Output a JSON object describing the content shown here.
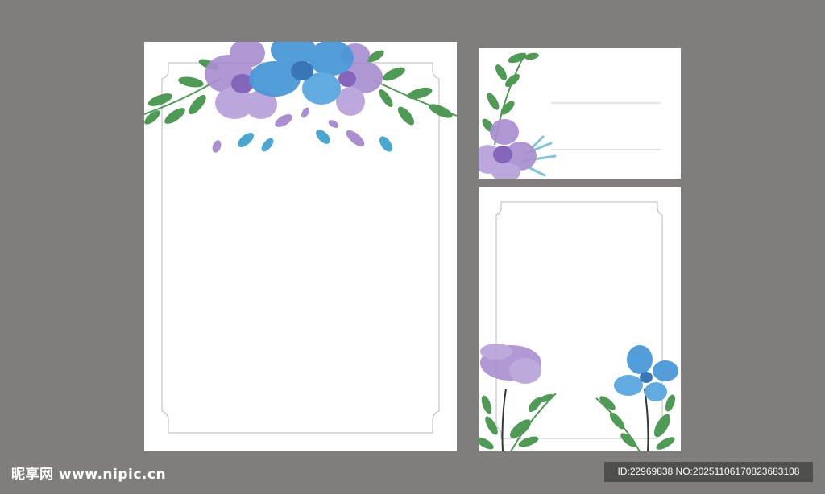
{
  "colors": {
    "background": "#7f7e7c",
    "card": "#ffffff",
    "frame_line": "#b9b9b9",
    "purple": "#a98fd0",
    "purple_dark": "#7b58b5",
    "blue": "#4a98d8",
    "blue_dark": "#2f6fb3",
    "leaf": "#4f9a55"
  },
  "watermark": {
    "site": "昵享网 www.nipic.cn",
    "id_text": "ID:22969838 NO:20251106170823683108"
  }
}
